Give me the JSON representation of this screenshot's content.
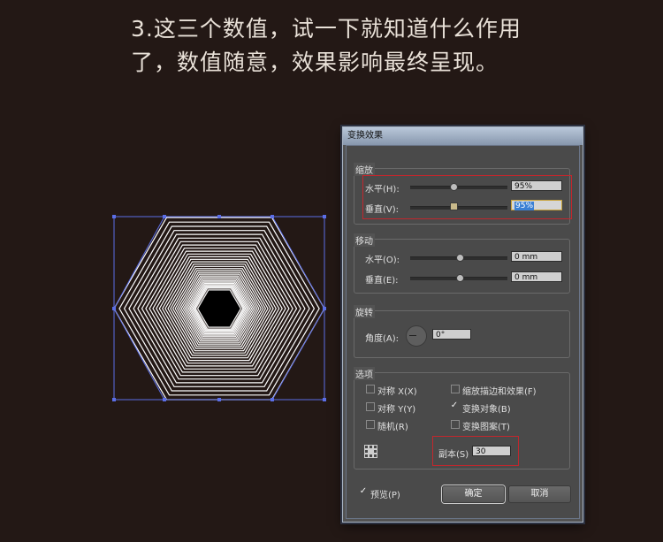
{
  "caption": {
    "line1": "3.这三个数值，试一下就知道什么作用",
    "line2": "了，数值随意，效果影响最终呈现。"
  },
  "dialog": {
    "title": "变换效果",
    "scale": {
      "group_label": "缩放",
      "horizontal_label": "水平(H):",
      "horizontal_value": "95%",
      "horizontal_slider": 0.75,
      "vertical_label": "垂直(V):",
      "vertical_value": "95%",
      "vertical_slider": 0.75
    },
    "move": {
      "group_label": "移动",
      "horizontal_label": "水平(O):",
      "horizontal_value": "0 mm",
      "horizontal_slider": 0.5,
      "vertical_label": "垂直(E):",
      "vertical_value": "0 mm",
      "vertical_slider": 0.5
    },
    "rotate": {
      "group_label": "旋转",
      "angle_label": "角度(A):",
      "angle_value": "0°"
    },
    "options": {
      "group_label": "选项",
      "reflect_x": {
        "label": "对称 X(X)",
        "checked": false
      },
      "reflect_y": {
        "label": "对称 Y(Y)",
        "checked": false
      },
      "random": {
        "label": "随机(R)",
        "checked": false
      },
      "scale_strokes": {
        "label": "缩放描边和效果(F)",
        "checked": false
      },
      "transform_objects": {
        "label": "变换对象(B)",
        "checked": true
      },
      "transform_patterns": {
        "label": "变换图案(T)",
        "checked": false
      }
    },
    "copies": {
      "label": "副本(S)",
      "value": "30"
    },
    "preview": {
      "label": "预览(P)",
      "checked": true
    },
    "ok_label": "确定",
    "cancel_label": "取消"
  },
  "colors": {
    "background": "#231815",
    "selection": "#5b6ee6",
    "highlight_box": "#c1272d",
    "hexagon_stroke": "#ffffff"
  },
  "artwork": {
    "shape": "hexagon",
    "copies": 30,
    "scale": 0.95
  }
}
